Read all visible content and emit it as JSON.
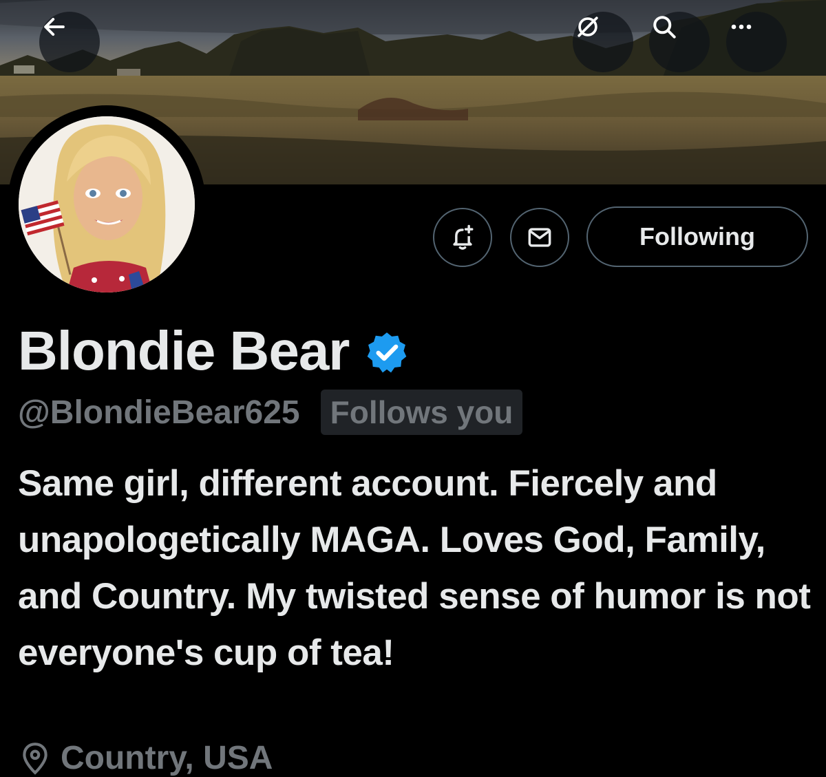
{
  "header": {
    "back_icon": "arrow-left-icon",
    "grok_icon": "grok-icon",
    "search_icon": "search-icon",
    "more_icon": "more-horizontal-icon"
  },
  "profile": {
    "display_name": "Blondie Bear",
    "verified": true,
    "verified_color": "#1d9bf0",
    "handle": "@BlondieBear625",
    "follows_you_label": "Follows you",
    "bio": "Same girl, different account. Fiercely and unapologetically MAGA. Loves God, Family, and Country. My twisted sense of humor is not everyone's cup of tea!",
    "location": "Country, USA"
  },
  "actions": {
    "notify_icon": "bell-plus-icon",
    "message_icon": "envelope-icon",
    "follow_label": "Following"
  }
}
